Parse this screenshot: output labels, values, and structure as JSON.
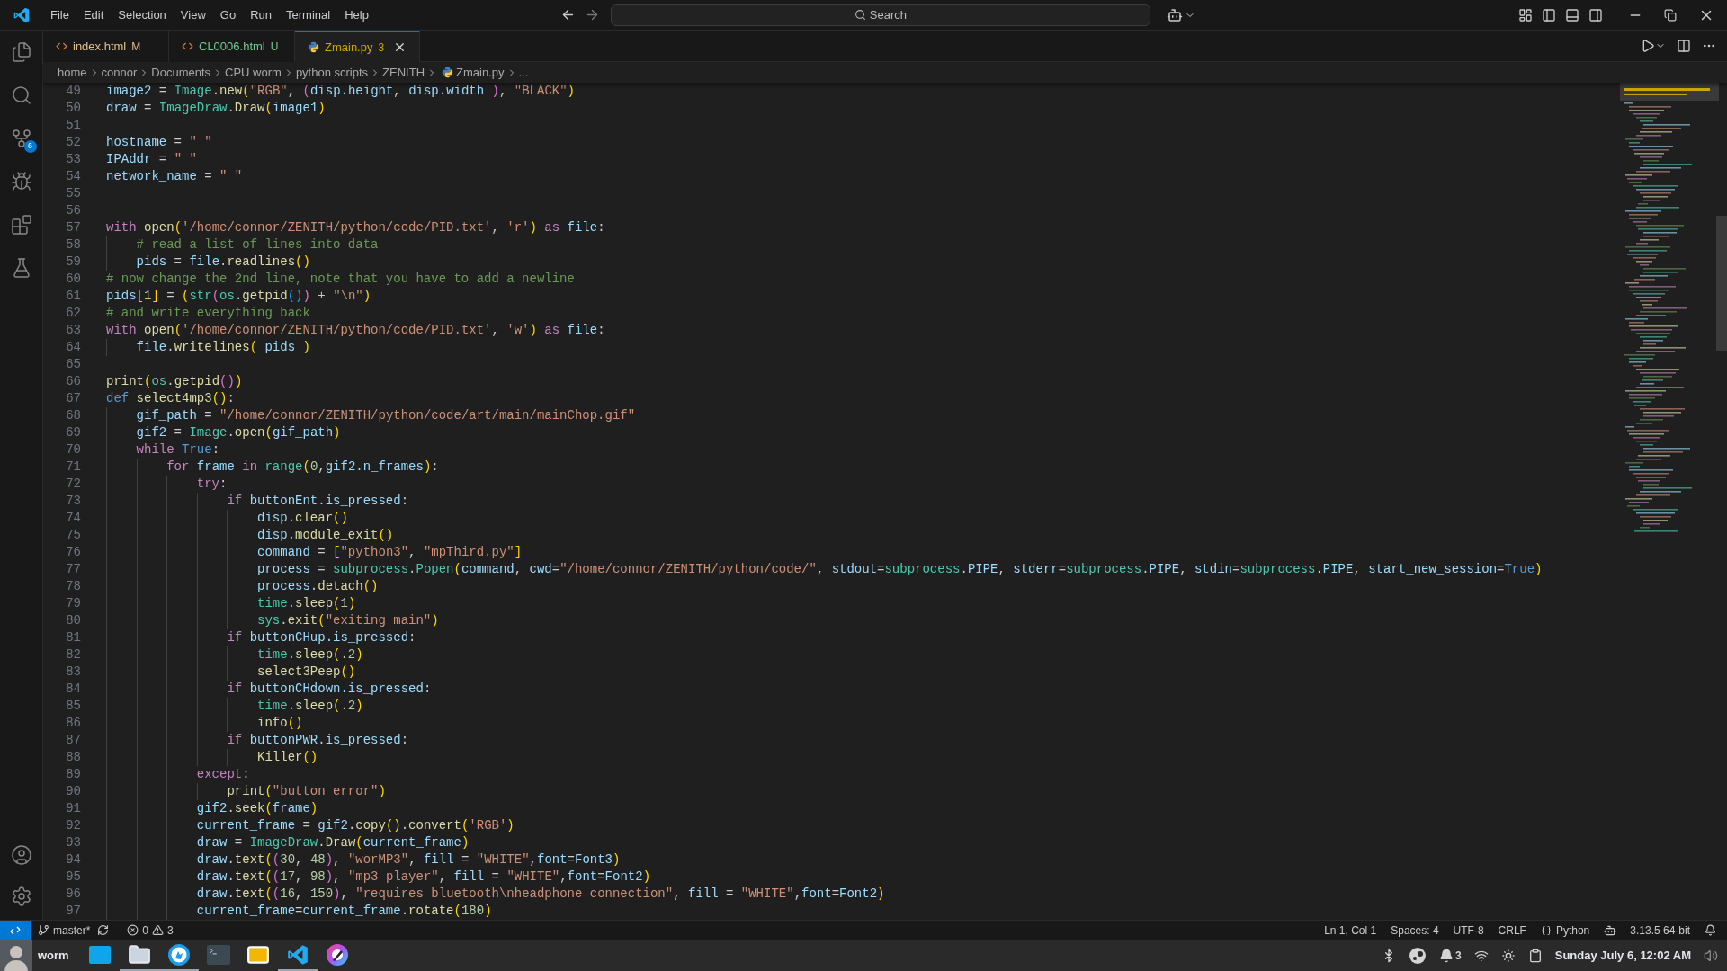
{
  "menu": [
    "File",
    "Edit",
    "Selection",
    "View",
    "Go",
    "Run",
    "Terminal",
    "Help"
  ],
  "search": {
    "placeholder": "Search"
  },
  "activity_badge": "6",
  "tabs": [
    {
      "label": "index.html",
      "status": "M",
      "kind": "html",
      "selected": false
    },
    {
      "label": "CL0006.html",
      "status": "U",
      "kind": "html",
      "selected": false
    },
    {
      "label": "Zmain.py",
      "status": "3",
      "kind": "python",
      "selected": true
    }
  ],
  "breadcrumb": [
    {
      "label": "home",
      "kind": "folder"
    },
    {
      "label": "connor",
      "kind": "folder"
    },
    {
      "label": "Documents",
      "kind": "folder"
    },
    {
      "label": "CPU worm",
      "kind": "folder"
    },
    {
      "label": "python scripts",
      "kind": "folder"
    },
    {
      "label": "ZENITH",
      "kind": "folder"
    },
    {
      "label": "Zmain.py",
      "kind": "python"
    },
    {
      "label": "...",
      "kind": "more"
    }
  ],
  "editor": {
    "lines": [
      {
        "number": "49",
        "tokens": [
          {
            "text": "image2",
            "kind": "var"
          },
          {
            "text": " = ",
            "kind": "plain"
          },
          {
            "text": "Image",
            "kind": "class"
          },
          {
            "text": ".",
            "kind": "plain"
          },
          {
            "text": "new",
            "kind": "function"
          },
          {
            "text": "(",
            "kind": "bracket1"
          },
          {
            "text": "\"RGB\"",
            "kind": "string"
          },
          {
            "text": ", ",
            "kind": "plain"
          },
          {
            "text": "(",
            "kind": "bracket2"
          },
          {
            "text": "disp.height",
            "kind": "var"
          },
          {
            "text": ", ",
            "kind": "plain"
          },
          {
            "text": "disp.width",
            "kind": "var"
          },
          {
            "text": " )",
            "kind": "bracket2"
          },
          {
            "text": ", ",
            "kind": "plain"
          },
          {
            "text": "\"BLACK\"",
            "kind": "string"
          },
          {
            "text": ")",
            "kind": "bracket1"
          }
        ]
      },
      {
        "number": "50",
        "tokens": [
          {
            "text": "draw",
            "kind": "var"
          },
          {
            "text": " = ",
            "kind": "plain"
          },
          {
            "text": "ImageDraw",
            "kind": "class"
          },
          {
            "text": ".",
            "kind": "plain"
          },
          {
            "text": "Draw",
            "kind": "function"
          },
          {
            "text": "(",
            "kind": "bracket1"
          },
          {
            "text": "image1",
            "kind": "var"
          },
          {
            "text": ")",
            "kind": "bracket1"
          }
        ]
      },
      {
        "number": "51"
      },
      {
        "number": "52",
        "tokens": [
          {
            "text": "hostname",
            "kind": "var"
          },
          {
            "text": " = ",
            "kind": "plain"
          },
          {
            "text": "\" \"",
            "kind": "string"
          }
        ]
      },
      {
        "number": "53",
        "tokens": [
          {
            "text": "IPAddr",
            "kind": "var"
          },
          {
            "text": " = ",
            "kind": "plain"
          },
          {
            "text": "\" \"",
            "kind": "string"
          }
        ]
      },
      {
        "number": "54",
        "tokens": [
          {
            "text": "network_name",
            "kind": "var"
          },
          {
            "text": " = ",
            "kind": "plain"
          },
          {
            "text": "\" \"",
            "kind": "string"
          }
        ]
      },
      {
        "number": "55"
      },
      {
        "number": "56"
      },
      {
        "number": "57",
        "tokens": [
          {
            "text": "with",
            "kind": "keyword"
          },
          {
            "text": " open",
            "kind": "function"
          },
          {
            "text": "(",
            "kind": "bracket1"
          },
          {
            "text": "'/home/connor/ZENITH/python/code/PID.txt'",
            "kind": "string"
          },
          {
            "text": ", ",
            "kind": "plain"
          },
          {
            "text": "'r'",
            "kind": "string"
          },
          {
            "text": ")",
            "kind": "bracket1"
          },
          {
            "text": " as",
            "kind": "keyword"
          },
          {
            "text": " file",
            "kind": "var"
          },
          {
            "text": ":",
            "kind": "plain"
          }
        ]
      },
      {
        "number": "58",
        "tokens": [
          {
            "text": "    # read a list of lines into data",
            "kind": "comment"
          }
        ]
      },
      {
        "number": "59",
        "tokens": [
          {
            "text": "    pids",
            "kind": "var"
          },
          {
            "text": " = ",
            "kind": "plain"
          },
          {
            "text": "file",
            "kind": "var"
          },
          {
            "text": ".",
            "kind": "plain"
          },
          {
            "text": "readlines",
            "kind": "function"
          },
          {
            "text": "()",
            "kind": "bracket1"
          }
        ]
      },
      {
        "number": "60",
        "tokens": [
          {
            "text": "# now change the 2nd line, note that you have to add a newline",
            "kind": "comment"
          }
        ]
      },
      {
        "number": "61",
        "tokens": [
          {
            "text": "pids",
            "kind": "var"
          },
          {
            "text": "[",
            "kind": "bracket1"
          },
          {
            "text": "1",
            "kind": "number"
          },
          {
            "text": "]",
            "kind": "bracket1"
          },
          {
            "text": " = ",
            "kind": "plain"
          },
          {
            "text": "(",
            "kind": "bracket1"
          },
          {
            "text": "str",
            "kind": "class"
          },
          {
            "text": "(",
            "kind": "bracket2"
          },
          {
            "text": "os",
            "kind": "class"
          },
          {
            "text": ".",
            "kind": "plain"
          },
          {
            "text": "getpid",
            "kind": "function"
          },
          {
            "text": "()",
            "kind": "bracket3"
          },
          {
            "text": ")",
            "kind": "bracket2"
          },
          {
            "text": " + ",
            "kind": "plain"
          },
          {
            "text": "\"\\n\"",
            "kind": "string"
          },
          {
            "text": ")",
            "kind": "bracket1"
          }
        ]
      },
      {
        "number": "62",
        "tokens": [
          {
            "text": "# and write everything back",
            "kind": "comment"
          }
        ]
      },
      {
        "number": "63",
        "tokens": [
          {
            "text": "with",
            "kind": "keyword"
          },
          {
            "text": " open",
            "kind": "function"
          },
          {
            "text": "(",
            "kind": "bracket1"
          },
          {
            "text": "'/home/connor/ZENITH/python/code/PID.txt'",
            "kind": "string"
          },
          {
            "text": ", ",
            "kind": "plain"
          },
          {
            "text": "'w'",
            "kind": "string"
          },
          {
            "text": ")",
            "kind": "bracket1"
          },
          {
            "text": " as",
            "kind": "keyword"
          },
          {
            "text": " file",
            "kind": "var"
          },
          {
            "text": ":",
            "kind": "plain"
          }
        ]
      },
      {
        "number": "64",
        "tokens": [
          {
            "text": "    file",
            "kind": "var"
          },
          {
            "text": ".",
            "kind": "plain"
          },
          {
            "text": "writelines",
            "kind": "function"
          },
          {
            "text": "(",
            "kind": "bracket1"
          },
          {
            "text": " pids",
            "kind": "var"
          },
          {
            "text": " )",
            "kind": "bracket1"
          }
        ]
      },
      {
        "number": "65"
      },
      {
        "number": "66",
        "tokens": [
          {
            "text": "print",
            "kind": "function"
          },
          {
            "text": "(",
            "kind": "bracket1"
          },
          {
            "text": "os",
            "kind": "class"
          },
          {
            "text": ".",
            "kind": "plain"
          },
          {
            "text": "getpid",
            "kind": "function"
          },
          {
            "text": "()",
            "kind": "bracket2"
          },
          {
            "text": ")",
            "kind": "bracket1"
          }
        ]
      },
      {
        "number": "67",
        "tokens": [
          {
            "text": "def",
            "kind": "storage"
          },
          {
            "text": " select4mp3",
            "kind": "function"
          },
          {
            "text": "()",
            "kind": "bracket1"
          },
          {
            "text": ":",
            "kind": "plain"
          }
        ]
      },
      {
        "number": "68",
        "tokens": [
          {
            "text": "    gif_path",
            "kind": "var"
          },
          {
            "text": " = ",
            "kind": "plain"
          },
          {
            "text": "\"/home/connor/ZENITH/python/code/art/main/mainChop.gif\"",
            "kind": "string"
          }
        ]
      },
      {
        "number": "69",
        "tokens": [
          {
            "text": "    gif2",
            "kind": "var"
          },
          {
            "text": " = ",
            "kind": "plain"
          },
          {
            "text": "Image",
            "kind": "class"
          },
          {
            "text": ".",
            "kind": "plain"
          },
          {
            "text": "open",
            "kind": "function"
          },
          {
            "text": "(",
            "kind": "bracket1"
          },
          {
            "text": "gif_path",
            "kind": "var"
          },
          {
            "text": ")",
            "kind": "bracket1"
          }
        ]
      },
      {
        "number": "70",
        "tokens": [
          {
            "text": "    while",
            "kind": "keyword"
          },
          {
            "text": " True",
            "kind": "storage"
          },
          {
            "text": ":",
            "kind": "plain"
          }
        ]
      },
      {
        "number": "71",
        "tokens": [
          {
            "text": "        for",
            "kind": "keyword"
          },
          {
            "text": " frame",
            "kind": "var"
          },
          {
            "text": " in",
            "kind": "keyword"
          },
          {
            "text": " range",
            "kind": "class"
          },
          {
            "text": "(",
            "kind": "bracket1"
          },
          {
            "text": "0",
            "kind": "number"
          },
          {
            "text": ",",
            "kind": "plain"
          },
          {
            "text": "gif2.n_frames",
            "kind": "var"
          },
          {
            "text": ")",
            "kind": "bracket1"
          },
          {
            "text": ":",
            "kind": "plain"
          }
        ]
      },
      {
        "number": "72",
        "tokens": [
          {
            "text": "            try",
            "kind": "keyword"
          },
          {
            "text": ":",
            "kind": "plain"
          }
        ]
      },
      {
        "number": "73",
        "tokens": [
          {
            "text": "                if",
            "kind": "keyword"
          },
          {
            "text": " buttonEnt.is_pressed",
            "kind": "var"
          },
          {
            "text": ":",
            "kind": "plain"
          }
        ]
      },
      {
        "number": "74",
        "tokens": [
          {
            "text": "                    disp",
            "kind": "var"
          },
          {
            "text": ".",
            "kind": "plain"
          },
          {
            "text": "clear",
            "kind": "function"
          },
          {
            "text": "()",
            "kind": "bracket1"
          }
        ]
      },
      {
        "number": "75",
        "tokens": [
          {
            "text": "                    disp",
            "kind": "var"
          },
          {
            "text": ".",
            "kind": "plain"
          },
          {
            "text": "module_exit",
            "kind": "function"
          },
          {
            "text": "()",
            "kind": "bracket1"
          }
        ]
      },
      {
        "number": "76",
        "tokens": [
          {
            "text": "                    command",
            "kind": "var"
          },
          {
            "text": " = ",
            "kind": "plain"
          },
          {
            "text": "[",
            "kind": "bracket1"
          },
          {
            "text": "\"python3\"",
            "kind": "string"
          },
          {
            "text": ", ",
            "kind": "plain"
          },
          {
            "text": "\"mpThird.py\"",
            "kind": "string"
          },
          {
            "text": "]",
            "kind": "bracket1"
          }
        ]
      },
      {
        "number": "77",
        "tokens": [
          {
            "text": "                    process",
            "kind": "var"
          },
          {
            "text": " = ",
            "kind": "plain"
          },
          {
            "text": "subprocess",
            "kind": "class"
          },
          {
            "text": ".",
            "kind": "plain"
          },
          {
            "text": "Popen",
            "kind": "class"
          },
          {
            "text": "(",
            "kind": "bracket1"
          },
          {
            "text": "command",
            "kind": "var"
          },
          {
            "text": ", ",
            "kind": "plain"
          },
          {
            "text": "cwd",
            "kind": "var"
          },
          {
            "text": "=",
            "kind": "plain"
          },
          {
            "text": "\"/home/connor/ZENITH/python/code/\"",
            "kind": "string"
          },
          {
            "text": ", ",
            "kind": "plain"
          },
          {
            "text": "stdout",
            "kind": "var"
          },
          {
            "text": "=",
            "kind": "plain"
          },
          {
            "text": "subprocess",
            "kind": "class"
          },
          {
            "text": ".",
            "kind": "plain"
          },
          {
            "text": "PIPE",
            "kind": "var"
          },
          {
            "text": ", ",
            "kind": "plain"
          },
          {
            "text": "stderr",
            "kind": "var"
          },
          {
            "text": "=",
            "kind": "plain"
          },
          {
            "text": "subprocess",
            "kind": "class"
          },
          {
            "text": ".",
            "kind": "plain"
          },
          {
            "text": "PIPE",
            "kind": "var"
          },
          {
            "text": ", ",
            "kind": "plain"
          },
          {
            "text": "stdin",
            "kind": "var"
          },
          {
            "text": "=",
            "kind": "plain"
          },
          {
            "text": "subprocess",
            "kind": "class"
          },
          {
            "text": ".",
            "kind": "plain"
          },
          {
            "text": "PIPE",
            "kind": "var"
          },
          {
            "text": ", ",
            "kind": "plain"
          },
          {
            "text": "start_new_session",
            "kind": "var"
          },
          {
            "text": "=",
            "kind": "plain"
          },
          {
            "text": "True",
            "kind": "storage"
          },
          {
            "text": ")",
            "kind": "bracket1"
          }
        ]
      },
      {
        "number": "78",
        "tokens": [
          {
            "text": "                    process",
            "kind": "var"
          },
          {
            "text": ".",
            "kind": "plain"
          },
          {
            "text": "detach",
            "kind": "function"
          },
          {
            "text": "()",
            "kind": "bracket1"
          }
        ]
      },
      {
        "number": "79",
        "tokens": [
          {
            "text": "                    time",
            "kind": "class"
          },
          {
            "text": ".",
            "kind": "plain"
          },
          {
            "text": "sleep",
            "kind": "function"
          },
          {
            "text": "(",
            "kind": "bracket1"
          },
          {
            "text": "1",
            "kind": "number"
          },
          {
            "text": ")",
            "kind": "bracket1"
          }
        ]
      },
      {
        "number": "80",
        "tokens": [
          {
            "text": "                    sys",
            "kind": "class"
          },
          {
            "text": ".",
            "kind": "plain"
          },
          {
            "text": "exit",
            "kind": "function"
          },
          {
            "text": "(",
            "kind": "bracket1"
          },
          {
            "text": "\"exiting main\"",
            "kind": "string"
          },
          {
            "text": ")",
            "kind": "bracket1"
          }
        ]
      },
      {
        "number": "81",
        "tokens": [
          {
            "text": "                if",
            "kind": "keyword"
          },
          {
            "text": " buttonCHup.is_pressed",
            "kind": "var"
          },
          {
            "text": ":",
            "kind": "plain"
          }
        ]
      },
      {
        "number": "82",
        "tokens": [
          {
            "text": "                    time",
            "kind": "class"
          },
          {
            "text": ".",
            "kind": "plain"
          },
          {
            "text": "sleep",
            "kind": "function"
          },
          {
            "text": "(",
            "kind": "bracket1"
          },
          {
            "text": ".2",
            "kind": "number"
          },
          {
            "text": ")",
            "kind": "bracket1"
          }
        ]
      },
      {
        "number": "83",
        "tokens": [
          {
            "text": "                    select3Peep",
            "kind": "function"
          },
          {
            "text": "()",
            "kind": "bracket1"
          }
        ]
      },
      {
        "number": "84",
        "tokens": [
          {
            "text": "                if",
            "kind": "keyword"
          },
          {
            "text": " buttonCHdown.is_pressed",
            "kind": "var"
          },
          {
            "text": ":",
            "kind": "plain"
          }
        ]
      },
      {
        "number": "85",
        "tokens": [
          {
            "text": "                    time",
            "kind": "class"
          },
          {
            "text": ".",
            "kind": "plain"
          },
          {
            "text": "sleep",
            "kind": "function"
          },
          {
            "text": "(",
            "kind": "bracket1"
          },
          {
            "text": ".2",
            "kind": "number"
          },
          {
            "text": ")",
            "kind": "bracket1"
          }
        ]
      },
      {
        "number": "86",
        "tokens": [
          {
            "text": "                    info",
            "kind": "function"
          },
          {
            "text": "()",
            "kind": "bracket1"
          }
        ]
      },
      {
        "number": "87",
        "tokens": [
          {
            "text": "                if",
            "kind": "keyword"
          },
          {
            "text": " buttonPWR.is_pressed",
            "kind": "var"
          },
          {
            "text": ":",
            "kind": "plain"
          }
        ]
      },
      {
        "number": "88",
        "tokens": [
          {
            "text": "                    Killer",
            "kind": "function"
          },
          {
            "text": "()",
            "kind": "bracket1"
          }
        ]
      },
      {
        "number": "89",
        "tokens": [
          {
            "text": "            except",
            "kind": "keyword"
          },
          {
            "text": ":",
            "kind": "plain"
          }
        ]
      },
      {
        "number": "90",
        "tokens": [
          {
            "text": "                print",
            "kind": "function"
          },
          {
            "text": "(",
            "kind": "bracket1"
          },
          {
            "text": "\"button error\"",
            "kind": "string"
          },
          {
            "text": ")",
            "kind": "bracket1"
          }
        ]
      },
      {
        "number": "91",
        "tokens": [
          {
            "text": "            gif2",
            "kind": "var"
          },
          {
            "text": ".",
            "kind": "plain"
          },
          {
            "text": "seek",
            "kind": "function"
          },
          {
            "text": "(",
            "kind": "bracket1"
          },
          {
            "text": "frame",
            "kind": "var"
          },
          {
            "text": ")",
            "kind": "bracket1"
          }
        ]
      },
      {
        "number": "92",
        "tokens": [
          {
            "text": "            current_frame",
            "kind": "var"
          },
          {
            "text": " = ",
            "kind": "plain"
          },
          {
            "text": "gif2",
            "kind": "var"
          },
          {
            "text": ".",
            "kind": "plain"
          },
          {
            "text": "copy",
            "kind": "function"
          },
          {
            "text": "()",
            "kind": "bracket1"
          },
          {
            "text": ".",
            "kind": "plain"
          },
          {
            "text": "convert",
            "kind": "function"
          },
          {
            "text": "(",
            "kind": "bracket1"
          },
          {
            "text": "'RGB'",
            "kind": "string"
          },
          {
            "text": ")",
            "kind": "bracket1"
          }
        ]
      },
      {
        "number": "93",
        "tokens": [
          {
            "text": "            draw",
            "kind": "var"
          },
          {
            "text": " = ",
            "kind": "plain"
          },
          {
            "text": "ImageDraw",
            "kind": "class"
          },
          {
            "text": ".",
            "kind": "plain"
          },
          {
            "text": "Draw",
            "kind": "function"
          },
          {
            "text": "(",
            "kind": "bracket1"
          },
          {
            "text": "current_frame",
            "kind": "var"
          },
          {
            "text": ")",
            "kind": "bracket1"
          }
        ]
      },
      {
        "number": "94",
        "tokens": [
          {
            "text": "            draw",
            "kind": "var"
          },
          {
            "text": ".",
            "kind": "plain"
          },
          {
            "text": "text",
            "kind": "function"
          },
          {
            "text": "(",
            "kind": "bracket1"
          },
          {
            "text": "(",
            "kind": "bracket2"
          },
          {
            "text": "30",
            "kind": "number"
          },
          {
            "text": ", ",
            "kind": "plain"
          },
          {
            "text": "48",
            "kind": "number"
          },
          {
            "text": ")",
            "kind": "bracket2"
          },
          {
            "text": ", ",
            "kind": "plain"
          },
          {
            "text": "\"worMP3\"",
            "kind": "string"
          },
          {
            "text": ", ",
            "kind": "plain"
          },
          {
            "text": "fill",
            "kind": "var"
          },
          {
            "text": " = ",
            "kind": "plain"
          },
          {
            "text": "\"WHITE\"",
            "kind": "string"
          },
          {
            "text": ",",
            "kind": "plain"
          },
          {
            "text": "font",
            "kind": "var"
          },
          {
            "text": "=",
            "kind": "plain"
          },
          {
            "text": "Font3",
            "kind": "var"
          },
          {
            "text": ")",
            "kind": "bracket1"
          }
        ]
      },
      {
        "number": "95",
        "tokens": [
          {
            "text": "            draw",
            "kind": "var"
          },
          {
            "text": ".",
            "kind": "plain"
          },
          {
            "text": "text",
            "kind": "function"
          },
          {
            "text": "(",
            "kind": "bracket1"
          },
          {
            "text": "(",
            "kind": "bracket2"
          },
          {
            "text": "17",
            "kind": "number"
          },
          {
            "text": ", ",
            "kind": "plain"
          },
          {
            "text": "98",
            "kind": "number"
          },
          {
            "text": ")",
            "kind": "bracket2"
          },
          {
            "text": ", ",
            "kind": "plain"
          },
          {
            "text": "\"mp3 player\"",
            "kind": "string"
          },
          {
            "text": ", ",
            "kind": "plain"
          },
          {
            "text": "fill",
            "kind": "var"
          },
          {
            "text": " = ",
            "kind": "plain"
          },
          {
            "text": "\"WHITE\"",
            "kind": "string"
          },
          {
            "text": ",",
            "kind": "plain"
          },
          {
            "text": "font",
            "kind": "var"
          },
          {
            "text": "=",
            "kind": "plain"
          },
          {
            "text": "Font2",
            "kind": "var"
          },
          {
            "text": ")",
            "kind": "bracket1"
          }
        ]
      },
      {
        "number": "96",
        "tokens": [
          {
            "text": "            draw",
            "kind": "var"
          },
          {
            "text": ".",
            "kind": "plain"
          },
          {
            "text": "text",
            "kind": "function"
          },
          {
            "text": "(",
            "kind": "bracket1"
          },
          {
            "text": "(",
            "kind": "bracket2"
          },
          {
            "text": "16",
            "kind": "number"
          },
          {
            "text": ", ",
            "kind": "plain"
          },
          {
            "text": "150",
            "kind": "number"
          },
          {
            "text": ")",
            "kind": "bracket2"
          },
          {
            "text": ", ",
            "kind": "plain"
          },
          {
            "text": "\"requires bluetooth\\nheadphone connection\"",
            "kind": "string"
          },
          {
            "text": ", ",
            "kind": "plain"
          },
          {
            "text": "fill",
            "kind": "var"
          },
          {
            "text": " = ",
            "kind": "plain"
          },
          {
            "text": "\"WHITE\"",
            "kind": "string"
          },
          {
            "text": ",",
            "kind": "plain"
          },
          {
            "text": "font",
            "kind": "var"
          },
          {
            "text": "=",
            "kind": "plain"
          },
          {
            "text": "Font2",
            "kind": "var"
          },
          {
            "text": ")",
            "kind": "bracket1"
          }
        ]
      },
      {
        "number": "97",
        "tokens": [
          {
            "text": "            current_frame",
            "kind": "var"
          },
          {
            "text": "=",
            "kind": "plain"
          },
          {
            "text": "current_frame",
            "kind": "var"
          },
          {
            "text": ".",
            "kind": "plain"
          },
          {
            "text": "rotate",
            "kind": "function"
          },
          {
            "text": "(",
            "kind": "bracket1"
          },
          {
            "text": "180",
            "kind": "number"
          },
          {
            "text": ")",
            "kind": "bracket1"
          }
        ]
      }
    ]
  },
  "status_bar": {
    "branch": "master*",
    "errors": "0",
    "warnings": "3",
    "right": [
      {
        "label": "Ln 1, Col 1",
        "kind": "text"
      },
      {
        "label": "Spaces: 4",
        "kind": "text"
      },
      {
        "label": "UTF-8",
        "kind": "text"
      },
      {
        "label": "CRLF",
        "kind": "text"
      },
      {
        "label": "Python",
        "kind": "language"
      },
      {
        "label": "3.13.5 64-bit",
        "kind": "interpreter"
      }
    ]
  },
  "taskbar": {
    "user": "worm",
    "apps": [
      {
        "kind": "files",
        "running": false
      },
      {
        "kind": "folder",
        "running": true
      },
      {
        "kind": "browser",
        "running": true
      },
      {
        "kind": "terminal",
        "running": false
      },
      {
        "kind": "mail",
        "running": false
      },
      {
        "kind": "editor",
        "running": true
      },
      {
        "kind": "paint",
        "running": false
      }
    ],
    "notifications": "3",
    "clock": "Sunday July 6, 12:02 AM"
  }
}
